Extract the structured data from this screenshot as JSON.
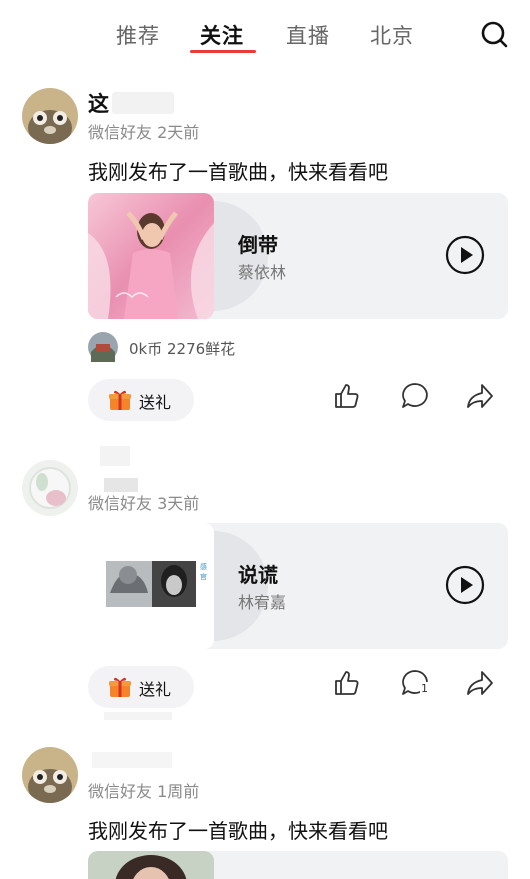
{
  "tabs": [
    {
      "label": "推荐",
      "active": false
    },
    {
      "label": "关注",
      "active": true
    },
    {
      "label": "直播",
      "active": false
    },
    {
      "label": "北京",
      "active": false
    }
  ],
  "posts": [
    {
      "username": "这",
      "source": "微信好友",
      "time": "2天前",
      "text": "我刚发布了一首歌曲，快来看看吧",
      "song": {
        "title": "倒带",
        "artist": "蔡依林"
      },
      "gift_summary": "0k币 2276鲜花",
      "gift_label": "送礼",
      "comment_count": ""
    },
    {
      "username": "",
      "source": "微信好友",
      "time": "3天前",
      "text": "",
      "song": {
        "title": "说谎",
        "artist": "林宥嘉"
      },
      "gift_label": "送礼",
      "comment_count": "1"
    },
    {
      "username": "",
      "source": "微信好友",
      "time": "1周前",
      "text": "我刚发布了一首歌曲，快来看看吧"
    }
  ],
  "colors": {
    "accent": "#ec3a3a",
    "card_bg": "#f1f2f4",
    "meta": "#8a8a8a"
  }
}
